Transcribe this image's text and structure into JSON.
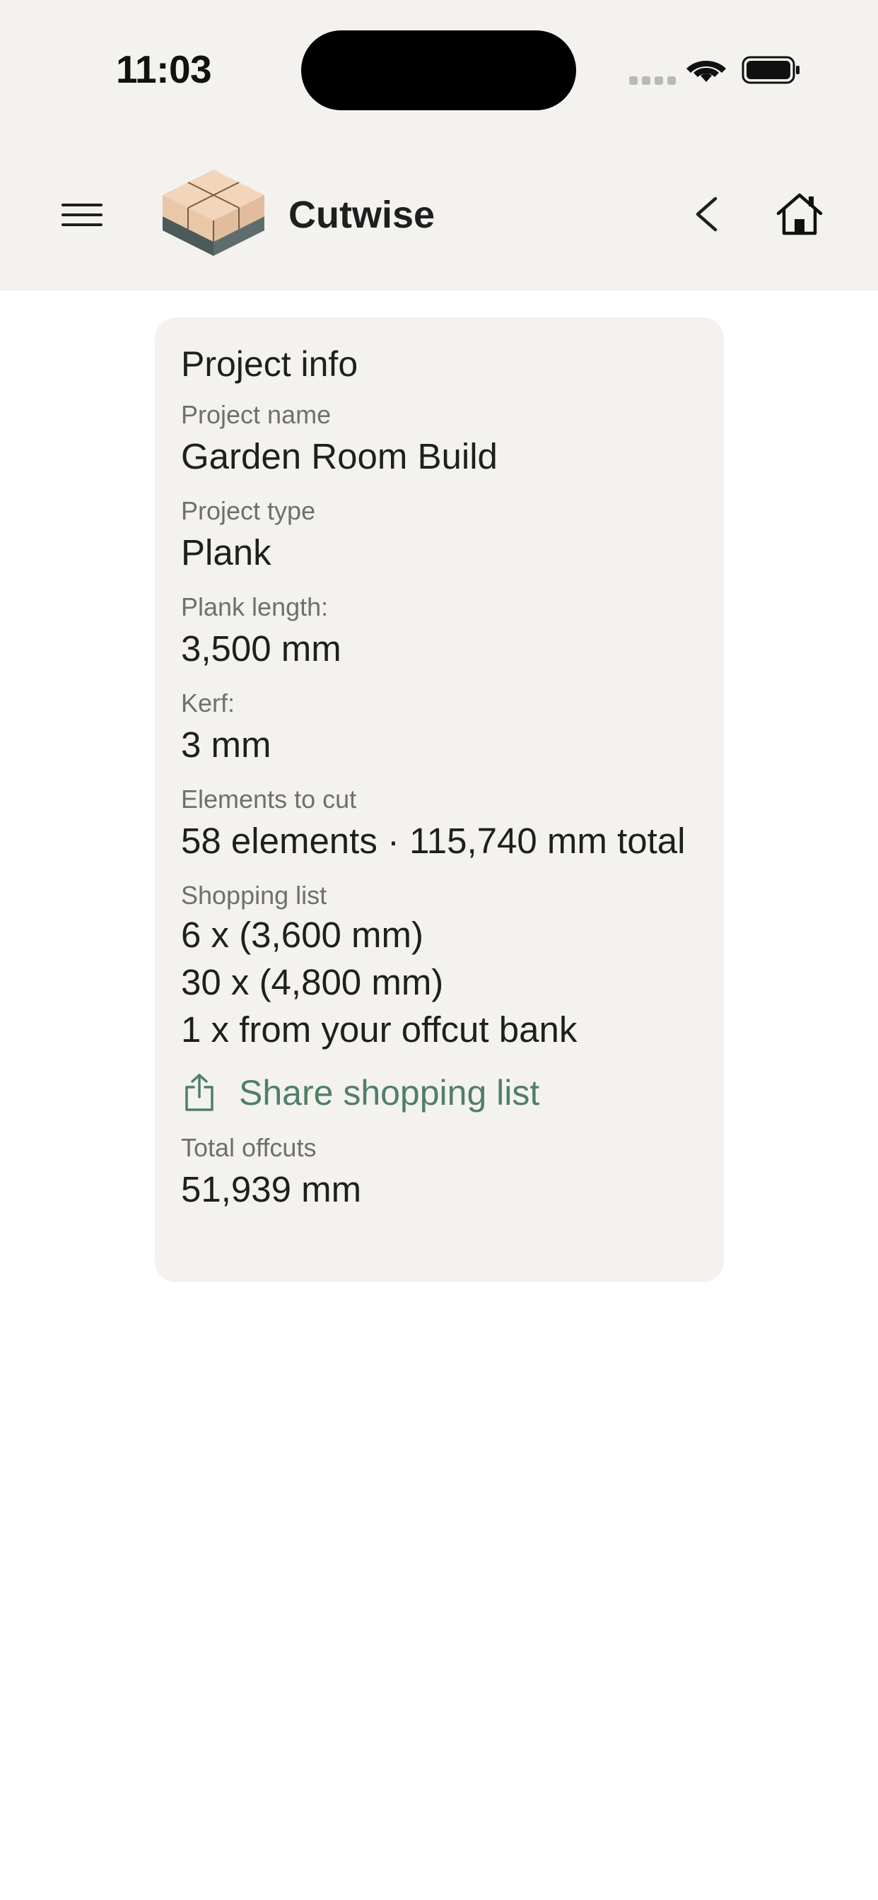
{
  "status_bar": {
    "time": "11:03",
    "icons": [
      "cellular-signal-icon",
      "wifi-icon",
      "battery-icon"
    ]
  },
  "header": {
    "app_name": "Cutwise",
    "icons": [
      "menu-icon",
      "app-logo",
      "back-icon",
      "home-icon"
    ]
  },
  "colors": {
    "header_background": "#f4f2ef",
    "card_background": "#f4f2ef",
    "accent_green": "#4f7f67",
    "label_grey": "#6f6f6f",
    "text_dark": "#1f1f1f"
  },
  "project_info": {
    "heading": "Project info",
    "project_name": {
      "label": "Project name",
      "value": "Garden Room Build"
    },
    "project_type": {
      "label": "Project type",
      "value": "Plank"
    },
    "plank_length": {
      "label": "Plank length:",
      "value": "3,500 mm"
    },
    "kerf": {
      "label": "Kerf:",
      "value": "3 mm"
    },
    "elements_to_cut": {
      "label": "Elements to cut",
      "value": "58 elements · 115,740 mm total"
    },
    "shopping_list": {
      "label": "Shopping list",
      "items": [
        "6 x (3,600 mm)",
        "30 x (4,800 mm)",
        "1 x from your offcut bank"
      ]
    },
    "share_action": {
      "label": "Share shopping list",
      "icon": "share-icon"
    },
    "total_offcuts": {
      "label": "Total offcuts",
      "value": "51,939 mm"
    }
  }
}
